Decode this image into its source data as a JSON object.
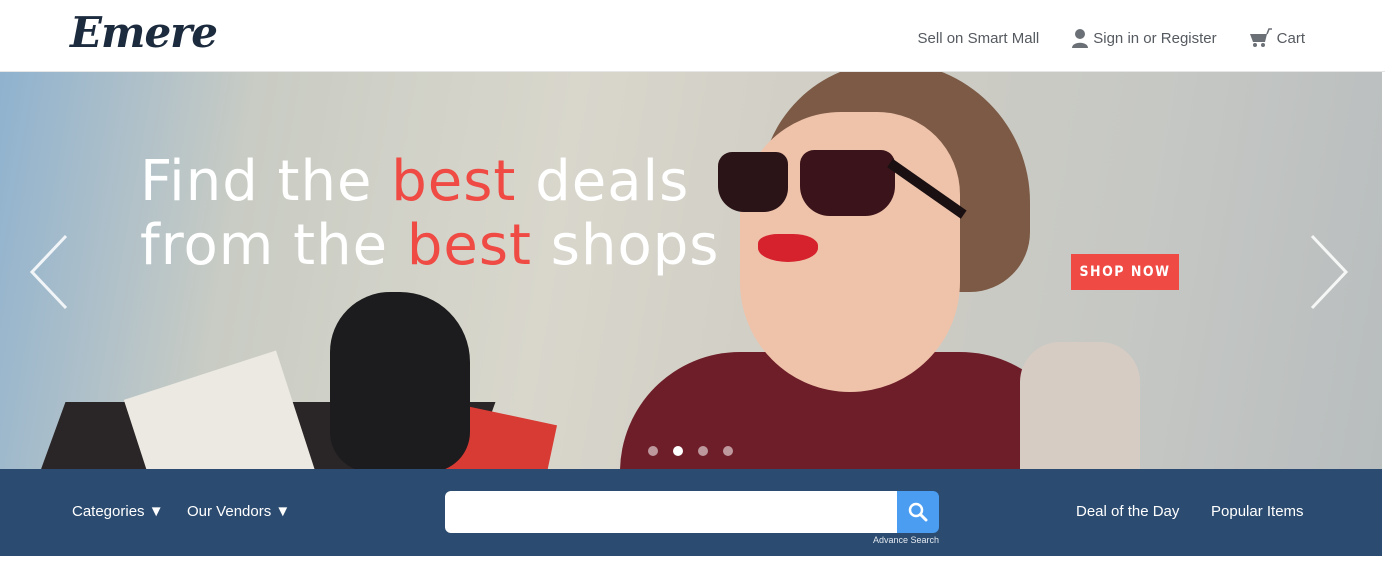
{
  "header": {
    "logo": "Emere",
    "links": {
      "sell": "Sell on Smart Mall",
      "signin": "Sign in or Register",
      "cart": "Cart"
    }
  },
  "hero": {
    "line1": {
      "a": "Find the ",
      "accent": "best",
      "b": " deals"
    },
    "line2": {
      "a": "from the ",
      "accent": "best",
      "b": " shops"
    },
    "cta": "SHOP NOW",
    "slides": {
      "count": 4,
      "active": 2
    }
  },
  "navbar": {
    "categories": "Categories ▼",
    "vendors": "Our Vendors ▼",
    "search": {
      "value": "",
      "placeholder": "",
      "advanced": "Advance Search"
    },
    "deal": "Deal of the Day",
    "popular": "Popular Items"
  },
  "colors": {
    "accent": "#ef4a43",
    "navbar": "#2b4b70",
    "search_button": "#4a9df0",
    "logo": "#1c2b3e"
  }
}
